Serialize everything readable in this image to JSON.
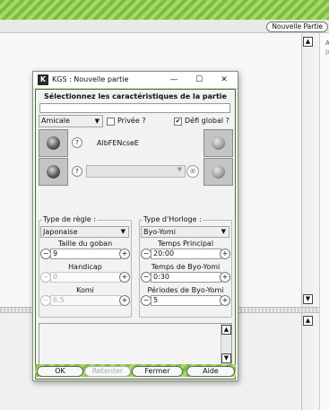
{
  "background_app": {
    "new_game_button": "Nouvelle Partie",
    "right_panel_chars": [
      "A",
      "p"
    ]
  },
  "dialog": {
    "title": "KGS : Nouvelle partie",
    "app_icon_letter": "K",
    "header": "Sélectionnez les caractéristiques de la partie",
    "game_type": "Amicale",
    "private_label": "Privée ?",
    "private_checked": false,
    "global_label": "Défi global ?",
    "global_checked": true,
    "player1_name": "AlbFENcseE",
    "player2_name": "",
    "help_glyph": "?",
    "remove_glyph": "⊗",
    "rules": {
      "group_label": "Type de règle :",
      "rule_type": "Japonaise",
      "board_size_label": "Taille du goban",
      "board_size": "9",
      "handicap_label": "Handicap",
      "handicap": "0",
      "komi_label": "Komi",
      "komi": "6.5"
    },
    "clock": {
      "group_label": "Type d'Horloge :",
      "clock_type": "Byo-Yomi",
      "main_time_label": "Temps Principal",
      "main_time": "20:00",
      "byoyomi_time_label": "Temps de Byo-Yomi",
      "byoyomi_time": "0:30",
      "byoyomi_periods_label": "Périodes de Byo-Yomi",
      "byoyomi_periods": "5"
    },
    "buttons": {
      "ok": "OK",
      "withdraw": "Retenter",
      "close": "Fermer",
      "help": "Aide"
    }
  }
}
